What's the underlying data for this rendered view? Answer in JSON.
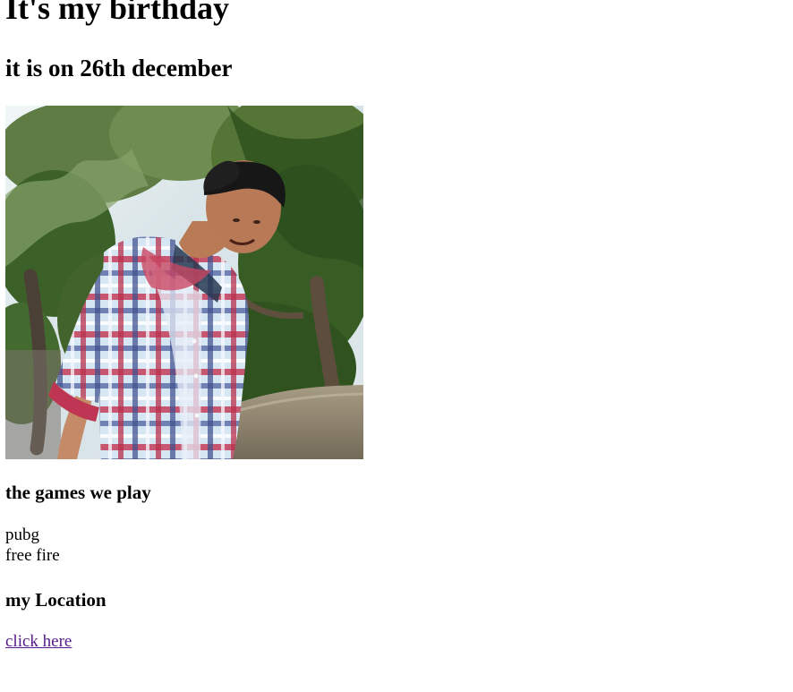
{
  "page": {
    "title": "It's my birthday",
    "subtitle": "it is on 26th december"
  },
  "photo": {
    "alt": "portrait in plaid shirt"
  },
  "games": {
    "heading": "the games we play",
    "items": [
      "pubg",
      "free fire"
    ]
  },
  "location": {
    "heading": "my Location",
    "link_label": "click here"
  },
  "colors": {
    "text": "#000000",
    "visited_link": "#551a8b",
    "background": "#ffffff"
  }
}
